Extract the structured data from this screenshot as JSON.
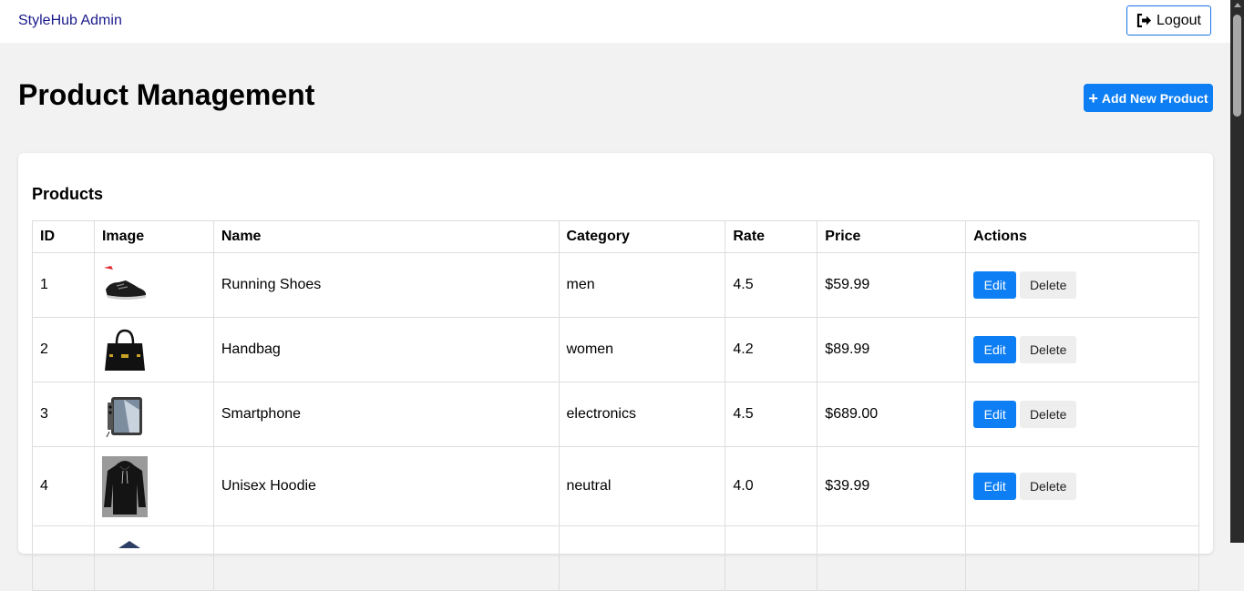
{
  "nav": {
    "brand": "StyleHub Admin",
    "logout_label": "Logout",
    "logout_icon": "sign-out-icon"
  },
  "page": {
    "title": "Product Management",
    "add_button_label": "Add New Product",
    "accent_color": "#0d7ef3"
  },
  "products": {
    "section_title": "Products",
    "columns": [
      "ID",
      "Image",
      "Name",
      "Category",
      "Rate",
      "Price",
      "Actions"
    ],
    "edit_label": "Edit",
    "delete_label": "Delete",
    "rows": [
      {
        "id": "1",
        "image": "running-shoes-thumbnail",
        "name": "Running Shoes",
        "category": "men",
        "rate": "4.5",
        "price": "$59.99"
      },
      {
        "id": "2",
        "image": "handbag-thumbnail",
        "name": "Handbag",
        "category": "women",
        "rate": "4.2",
        "price": "$89.99"
      },
      {
        "id": "3",
        "image": "smartphone-thumbnail",
        "name": "Smartphone",
        "category": "electronics",
        "rate": "4.5",
        "price": "$689.00"
      },
      {
        "id": "4",
        "image": "hoodie-thumbnail",
        "name": "Unisex Hoodie",
        "category": "neutral",
        "rate": "4.0",
        "price": "$39.99"
      }
    ]
  }
}
